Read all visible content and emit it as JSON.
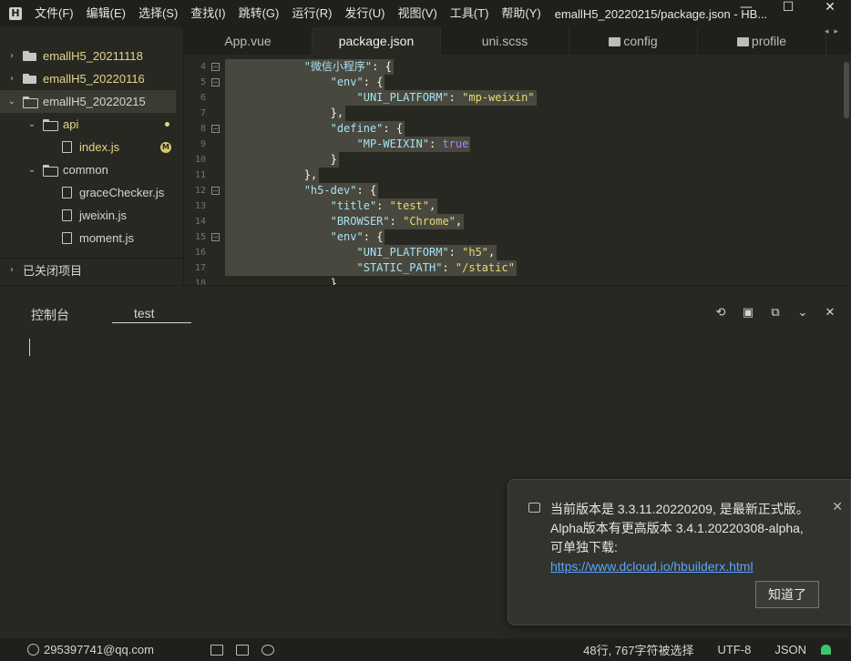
{
  "app": {
    "icon_letter": "H",
    "window_title": "emallH5_20220215/package.json - HB...",
    "menu": [
      "文件(F)",
      "编辑(E)",
      "选择(S)",
      "查找(I)",
      "跳转(G)",
      "运行(R)",
      "发行(U)",
      "视图(V)",
      "工具(T)",
      "帮助(Y)"
    ],
    "controls": {
      "minimize": "—",
      "maximize": "☐",
      "close": "✕"
    }
  },
  "sidebar": {
    "projects": [
      {
        "label": "emallH5_20211118"
      },
      {
        "label": "emallH5_20220116"
      },
      {
        "label": "emallH5_20220215"
      }
    ],
    "items": [
      {
        "label": "api",
        "type": "folder"
      },
      {
        "label": "index.js",
        "type": "file",
        "badge": "M"
      },
      {
        "label": "common",
        "type": "folder"
      },
      {
        "label": "graceChecker.js",
        "type": "file"
      },
      {
        "label": "jweixin.js",
        "type": "file"
      },
      {
        "label": "moment.js",
        "type": "file"
      }
    ],
    "closed_projects": "已关闭项目"
  },
  "tabs": [
    "App.vue",
    "package.json",
    "uni.scss",
    "config",
    "profile"
  ],
  "editor": {
    "lines": [
      {
        "n": "4",
        "t": "            \"微信小程序\": {"
      },
      {
        "n": "5",
        "t": "                \"env\": {"
      },
      {
        "n": "6",
        "t": "                    \"UNI_PLATFORM\": \"mp-weixin\""
      },
      {
        "n": "7",
        "t": "                },"
      },
      {
        "n": "8",
        "t": "                \"define\": {"
      },
      {
        "n": "9",
        "t": "                    \"MP-WEIXIN\": true"
      },
      {
        "n": "10",
        "t": "                }"
      },
      {
        "n": "11",
        "t": "            },"
      },
      {
        "n": "12",
        "t": "            \"h5-dev\": {"
      },
      {
        "n": "13",
        "t": "                \"title\": \"test\","
      },
      {
        "n": "14",
        "t": "                \"BROWSER\": \"Chrome\","
      },
      {
        "n": "15",
        "t": "                \"env\": {"
      },
      {
        "n": "16",
        "t": "                    \"UNI_PLATFORM\": \"h5\","
      },
      {
        "n": "17",
        "t": "                    \"STATIC_PATH\": \"/static\""
      },
      {
        "n": "18",
        "t": "                }"
      }
    ]
  },
  "panel": {
    "tabs": [
      "控制台",
      "test"
    ]
  },
  "notification": {
    "line1": "当前版本是 3.3.11.20220209, 是最新正式版。",
    "line2": "Alpha版本有更高版本 3.4.1.20220308-alpha,",
    "line3": "可单独下载:",
    "link": "https://www.dcloud.io/hbuilderx.html",
    "button": "知道了"
  },
  "status": {
    "user": "295397741@qq.com",
    "selection": "48行, 767字符被选择",
    "encoding": "UTF-8",
    "language": "JSON"
  }
}
